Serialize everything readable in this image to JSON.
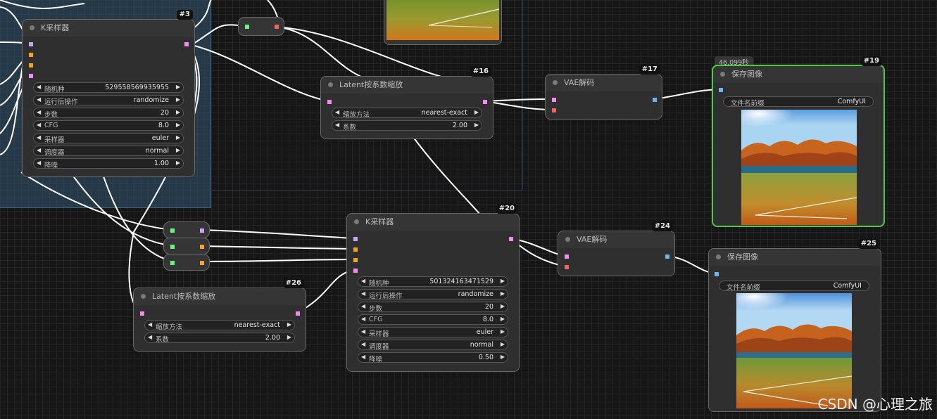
{
  "nodes": {
    "n3": {
      "badge": "#3",
      "title": "K采样器",
      "widgets": [
        {
          "label": "随机种",
          "value": "529558569935955"
        },
        {
          "label": "运行后操作",
          "value": "randomize"
        },
        {
          "label": "步数",
          "value": "20"
        },
        {
          "label": "CFG",
          "value": "8.0"
        },
        {
          "label": "采样器",
          "value": "euler"
        },
        {
          "label": "调度器",
          "value": "normal"
        },
        {
          "label": "降噪",
          "value": "1.00"
        }
      ]
    },
    "n16": {
      "badge": "#16",
      "title": "Latent按系数缩放",
      "widgets": [
        {
          "label": "缩放方法",
          "value": "nearest-exact"
        },
        {
          "label": "系数",
          "value": "2.00"
        }
      ]
    },
    "n17": {
      "badge": "#17",
      "title": "VAE解码"
    },
    "n19": {
      "badge": "#19",
      "title": "保存图像",
      "time": "46.099秒",
      "widgets": [
        {
          "label": "文件名前缀",
          "value": "ComfyUI"
        }
      ]
    },
    "n20": {
      "badge": "#20",
      "title": "K采样器",
      "widgets": [
        {
          "label": "随机种",
          "value": "501324163471529"
        },
        {
          "label": "运行后操作",
          "value": "randomize"
        },
        {
          "label": "步数",
          "value": "20"
        },
        {
          "label": "CFG",
          "value": "8.0"
        },
        {
          "label": "采样器",
          "value": "euler"
        },
        {
          "label": "调度器",
          "value": "normal"
        },
        {
          "label": "降噪",
          "value": "0.50"
        }
      ]
    },
    "n24": {
      "badge": "#24",
      "title": "VAE解码"
    },
    "n25": {
      "badge": "#25",
      "title": "保存图像",
      "widgets": [
        {
          "label": "文件名前缀",
          "value": "ComfyUI"
        }
      ]
    },
    "n26": {
      "badge": "#26",
      "title": "Latent按系数缩放",
      "widgets": [
        {
          "label": "缩放方法",
          "value": "nearest-exact"
        },
        {
          "label": "系数",
          "value": "2.00"
        }
      ]
    }
  },
  "colors": {
    "model": "#c9a3f5",
    "conditioning": "#f5a31c",
    "latent": "#f38cf0",
    "vae": "#f06464",
    "image": "#6ab6f2",
    "success_border": "#4ec94e"
  },
  "watermark": "CSDN @心理之旅"
}
